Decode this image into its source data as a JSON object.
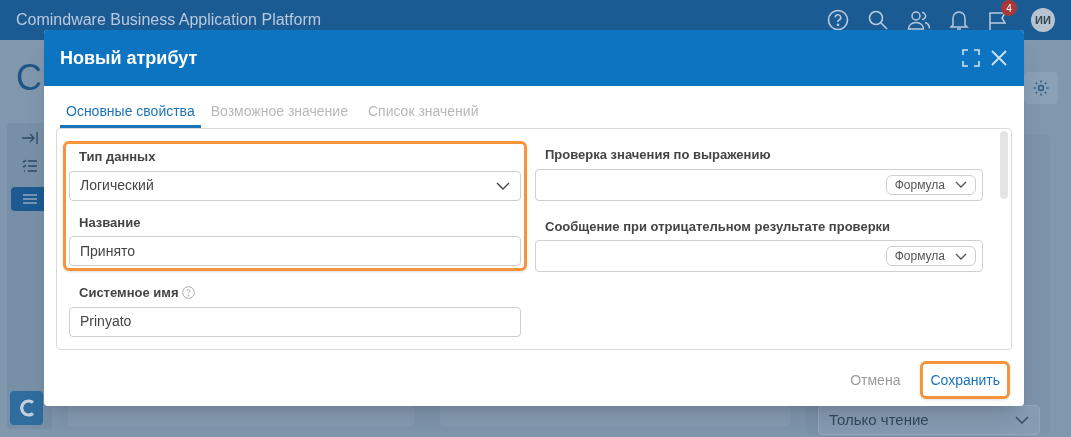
{
  "app": {
    "title": "Comindware Business Application Platform",
    "notification_count": "4",
    "avatar": "ИИ",
    "page_title_visible": "C",
    "access_select": "Только чтение"
  },
  "dialog": {
    "title": "Новый атрибут",
    "tabs": [
      {
        "label": "Основные свойства",
        "selected": true
      },
      {
        "label": "Возможное значение",
        "selected": false
      },
      {
        "label": "Список значений",
        "selected": false
      }
    ],
    "left_groups": [
      {
        "highlighted": true,
        "fields": [
          {
            "kind": "select",
            "label": "Тип данных",
            "value": "Логический",
            "help": false
          },
          {
            "kind": "text",
            "label": "Название",
            "value": "Принято",
            "help": false
          }
        ]
      },
      {
        "highlighted": false,
        "fields": [
          {
            "kind": "text",
            "label": "Системное имя",
            "value": "Prinyato",
            "help": true
          }
        ]
      }
    ],
    "right_fields": [
      {
        "kind": "formula",
        "label": "Проверка значения по выражению",
        "mode": "Формула"
      },
      {
        "kind": "formula",
        "label": "Сообщение при отрицательном результате проверки",
        "mode": "Формула"
      }
    ],
    "buttons": [
      {
        "label": "Отмена",
        "kind": "secondary",
        "highlighted": false
      },
      {
        "label": "Сохранить",
        "kind": "primary",
        "highlighted": true
      }
    ]
  }
}
